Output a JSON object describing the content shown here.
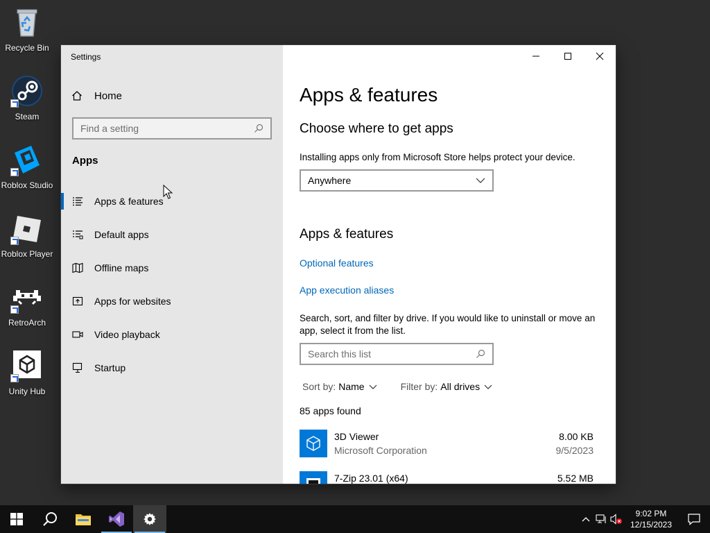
{
  "desktop": {
    "icons": [
      {
        "label": "Recycle Bin",
        "icon": "recycle-bin-icon"
      },
      {
        "label": "Steam",
        "icon": "steam-icon"
      },
      {
        "label": "Roblox Studio",
        "icon": "roblox-studio-icon"
      },
      {
        "label": "Roblox Player",
        "icon": "roblox-player-icon"
      },
      {
        "label": "RetroArch",
        "icon": "retroarch-icon"
      },
      {
        "label": "Unity Hub",
        "icon": "unity-hub-icon"
      }
    ]
  },
  "window": {
    "title": "Settings",
    "sidebar": {
      "home": "Home",
      "search_placeholder": "Find a setting",
      "section": "Apps",
      "items": [
        {
          "label": "Apps & features",
          "icon": "list-icon",
          "active": true
        },
        {
          "label": "Default apps",
          "icon": "default-apps-icon"
        },
        {
          "label": "Offline maps",
          "icon": "map-icon"
        },
        {
          "label": "Apps for websites",
          "icon": "web-apps-icon"
        },
        {
          "label": "Video playback",
          "icon": "video-icon"
        },
        {
          "label": "Startup",
          "icon": "startup-icon"
        }
      ]
    },
    "main": {
      "title": "Apps & features",
      "choose_heading": "Choose where to get apps",
      "choose_desc": "Installing apps only from Microsoft Store helps protect your device.",
      "source_value": "Anywhere",
      "features_heading": "Apps & features",
      "optional_features": "Optional features",
      "aliases": "App execution aliases",
      "search_desc": "Search, sort, and filter by drive. If you would like to uninstall or move an app, select it from the list.",
      "search_placeholder": "Search this list",
      "sort_label": "Sort by:",
      "sort_value": "Name",
      "filter_label": "Filter by:",
      "filter_value": "All drives",
      "count": "85 apps found",
      "apps": [
        {
          "name": "3D Viewer",
          "publisher": "Microsoft Corporation",
          "size": "8.00 KB",
          "date": "9/5/2023",
          "icon": "3d-viewer-icon"
        },
        {
          "name": "7-Zip 23.01 (x64)",
          "publisher": "",
          "size": "5.52 MB",
          "date": "",
          "icon": "7zip-icon"
        }
      ]
    }
  },
  "taskbar": {
    "time": "9:02 PM",
    "date": "12/15/2023",
    "accent": "#76b9ed"
  }
}
